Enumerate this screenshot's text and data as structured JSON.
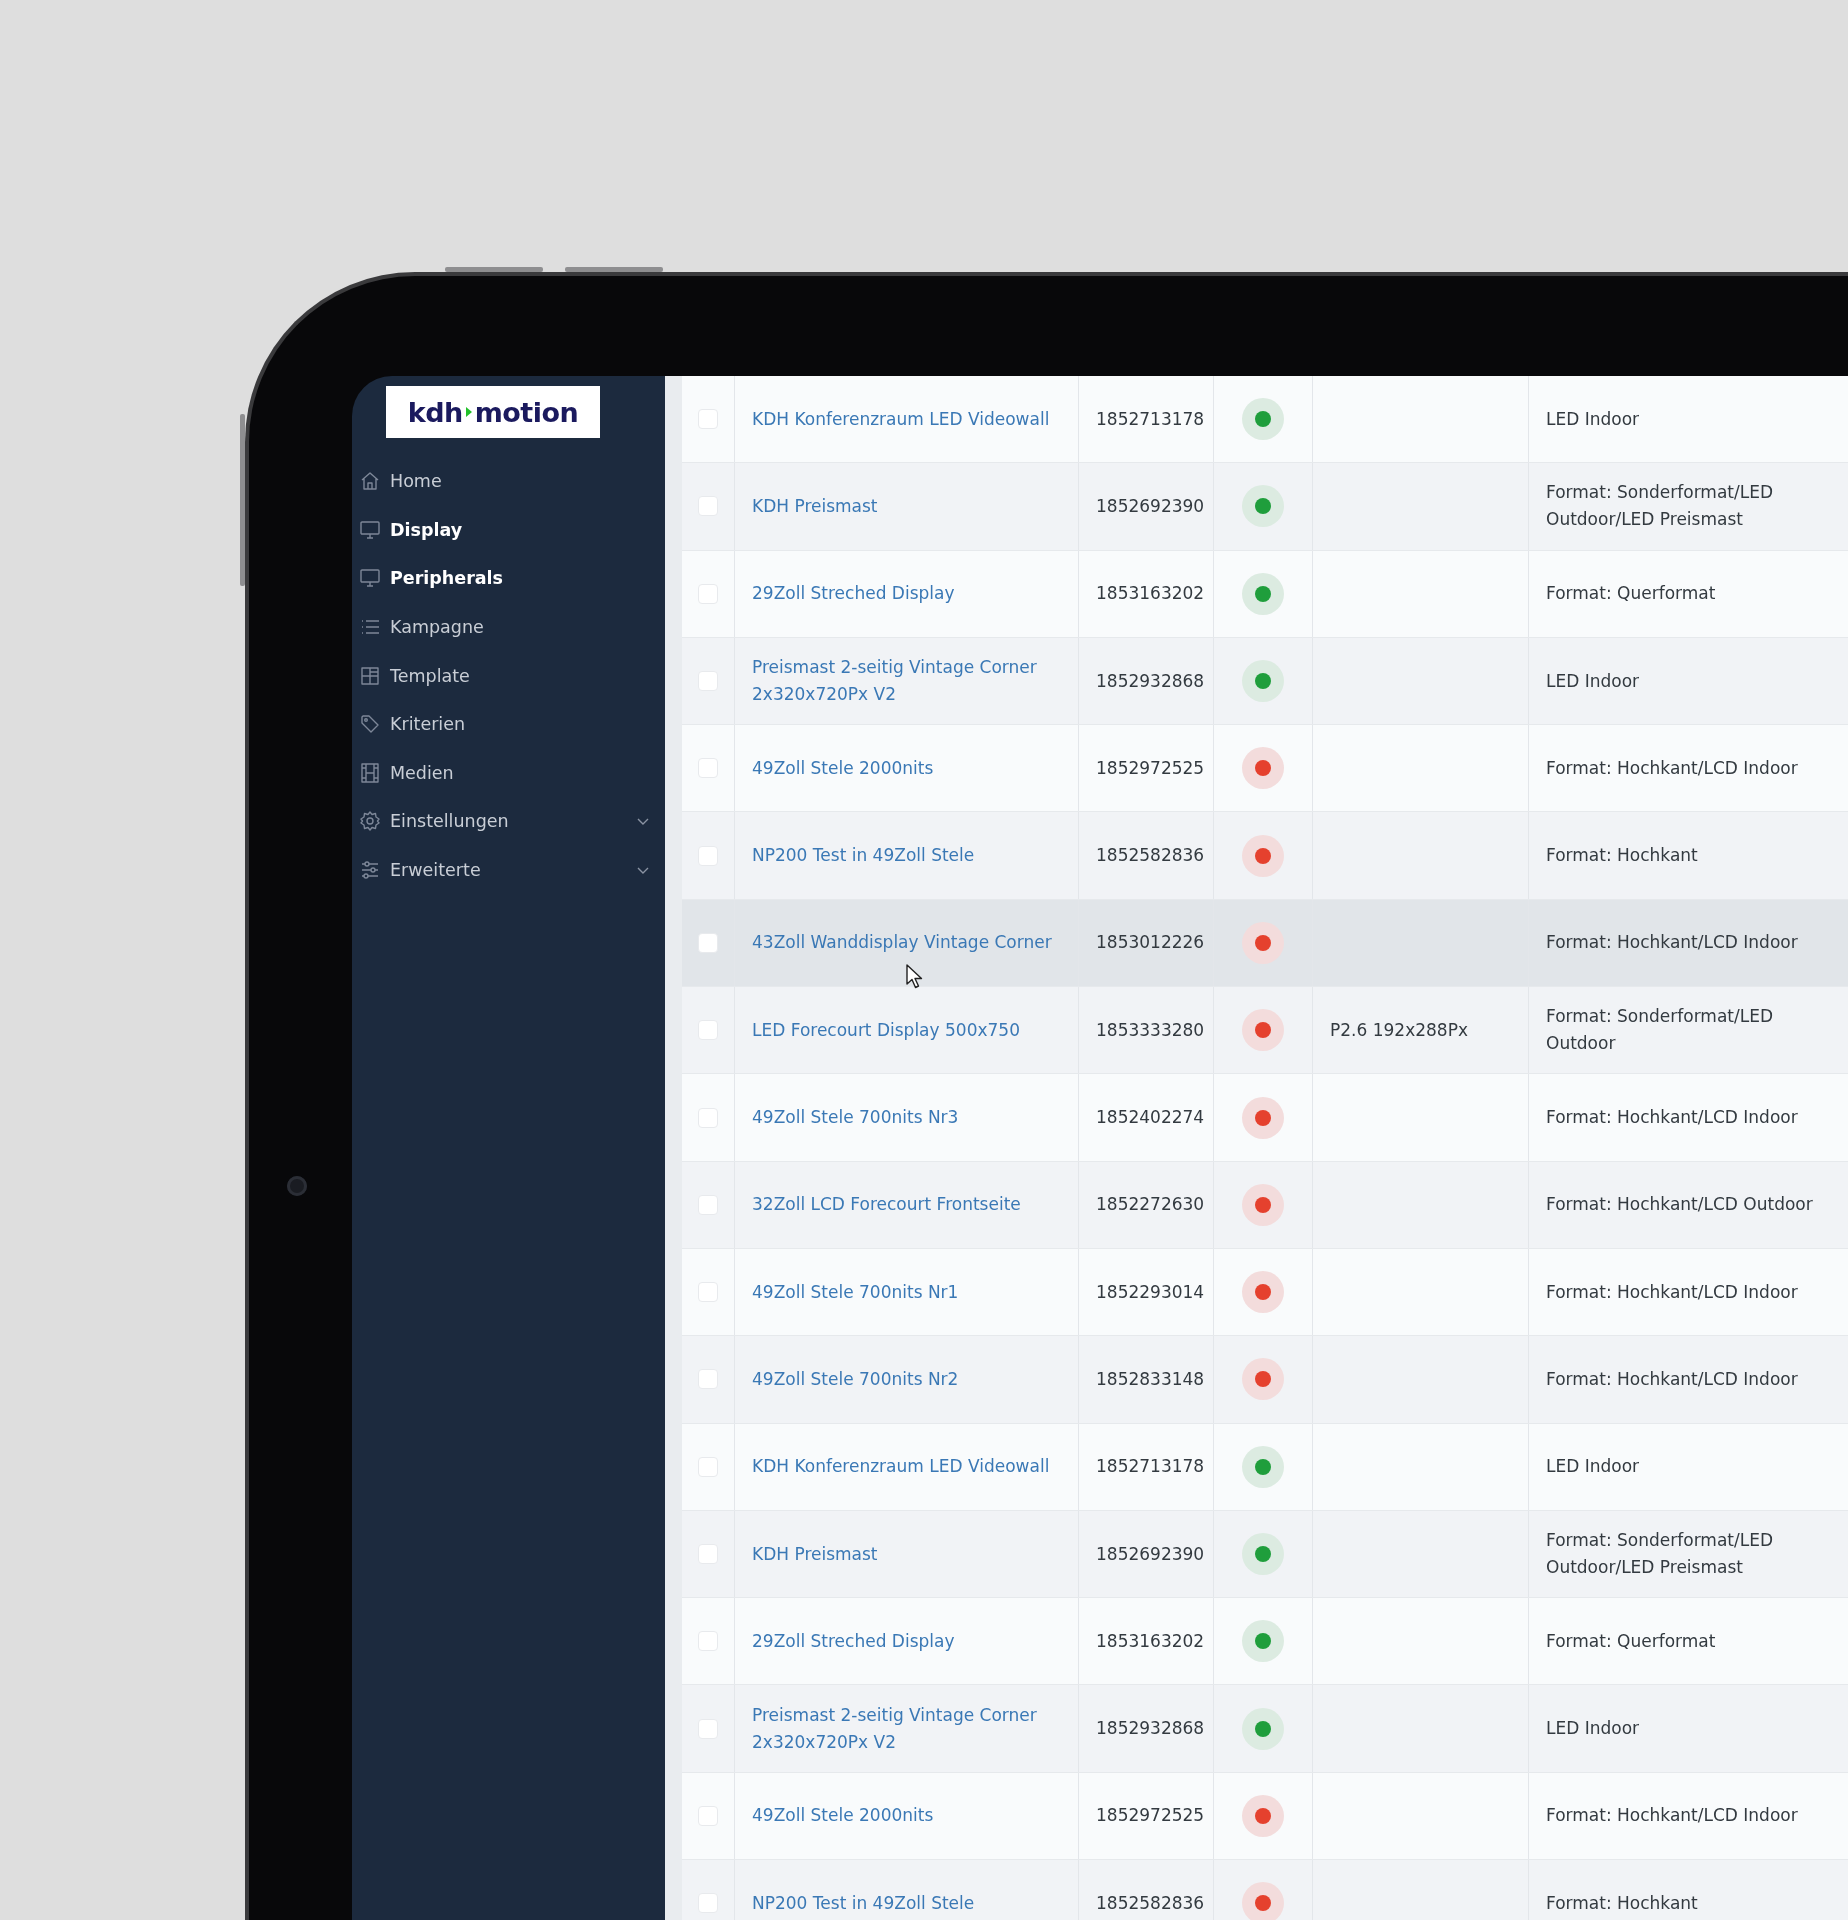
{
  "logo": {
    "left": "kdh",
    "right": "motion"
  },
  "sidebar": {
    "items": [
      {
        "label": "Home",
        "kind": "link",
        "active": false
      },
      {
        "label": "Display",
        "kind": "link",
        "active": true
      },
      {
        "label": "Peripherals",
        "kind": "link",
        "active": true
      },
      {
        "label": "Kampagne",
        "kind": "link",
        "active": false
      },
      {
        "label": "Template",
        "kind": "link",
        "active": false
      },
      {
        "label": "Kriterien",
        "kind": "link",
        "active": false
      },
      {
        "label": "Medien",
        "kind": "link",
        "active": false
      },
      {
        "label": "Einstellungen",
        "kind": "submenu",
        "active": false
      },
      {
        "label": "Erweiterte",
        "kind": "submenu",
        "active": false
      }
    ]
  },
  "table": {
    "rows": [
      {
        "checked": false,
        "hovered": false,
        "name": "KDH Konferenzraum LED Videowall",
        "id": "1852713178",
        "online": true,
        "format": "LED Indoor"
      },
      {
        "checked": false,
        "hovered": false,
        "name": "KDH Preismast",
        "id": "1852692390",
        "online": true,
        "format": "Format: Sonderformat/LED Outdoor/LED Preismast"
      },
      {
        "checked": false,
        "hovered": false,
        "name": "29Zoll Streched Display",
        "id": "1853163202",
        "online": true,
        "format": "Format: Querformat"
      },
      {
        "checked": false,
        "hovered": false,
        "name": "Preismast 2-seitig Vintage Corner 2x320x720Px V2",
        "id": "1852932868",
        "online": true,
        "format": "LED Indoor"
      },
      {
        "checked": false,
        "hovered": false,
        "name": "49Zoll Stele 2000nits",
        "id": "1852972525",
        "online": false,
        "format": "Format: Hochkant/LCD Indoor"
      },
      {
        "checked": false,
        "hovered": false,
        "name": "NP200 Test in 49Zoll Stele",
        "id": "1852582836",
        "online": false,
        "format": "Format: Hochkant"
      },
      {
        "checked": false,
        "hovered": true,
        "name": "43Zoll Wanddisplay Vintage Corner",
        "id": "1853012226",
        "online": false,
        "format": "Format: Hochkant/LCD Indoor"
      },
      {
        "checked": false,
        "hovered": false,
        "name": "LED Forecourt Display 500x750",
        "id": "1853333280",
        "online": false,
        "resolution": "P2.6 192x288Px",
        "format": "Format: Sonderformat/LED Outdoor"
      },
      {
        "checked": false,
        "hovered": false,
        "name": "49Zoll Stele 700nits Nr3",
        "id": "1852402274",
        "online": false,
        "format": "Format: Hochkant/LCD Indoor"
      },
      {
        "checked": false,
        "hovered": false,
        "name": "32Zoll LCD Forecourt Frontseite",
        "id": "1852272630",
        "online": false,
        "format": "Format: Hochkant/LCD Outdoor"
      },
      {
        "checked": false,
        "hovered": false,
        "name": "49Zoll Stele 700nits Nr1",
        "id": "1852293014",
        "online": false,
        "format": "Format: Hochkant/LCD Indoor"
      },
      {
        "checked": false,
        "hovered": false,
        "name": "49Zoll Stele 700nits Nr2",
        "id": "1852833148",
        "online": false,
        "format": "Format: Hochkant/LCD Indoor"
      },
      {
        "checked": false,
        "hovered": false,
        "name": "KDH Konferenzraum LED Videowall",
        "id": "1852713178",
        "online": true,
        "format": "LED Indoor"
      },
      {
        "checked": false,
        "hovered": false,
        "name": "KDH Preismast",
        "id": "1852692390",
        "online": true,
        "format": "Format: Sonderformat/LED Outdoor/LED Preismast"
      },
      {
        "checked": false,
        "hovered": false,
        "name": "29Zoll Streched Display",
        "id": "1853163202",
        "online": true,
        "format": "Format: Querformat"
      },
      {
        "checked": false,
        "hovered": false,
        "name": "Preismast 2-seitig Vintage Corner 2x320x720Px V2",
        "id": "1852932868",
        "online": true,
        "format": "LED Indoor"
      },
      {
        "checked": false,
        "hovered": false,
        "name": "49Zoll Stele 2000nits",
        "id": "1852972525",
        "online": false,
        "format": "Format: Hochkant/LCD Indoor"
      },
      {
        "checked": false,
        "hovered": false,
        "name": "NP200 Test in 49Zoll Stele",
        "id": "1852582836",
        "online": false,
        "format": "Format: Hochkant"
      }
    ]
  }
}
